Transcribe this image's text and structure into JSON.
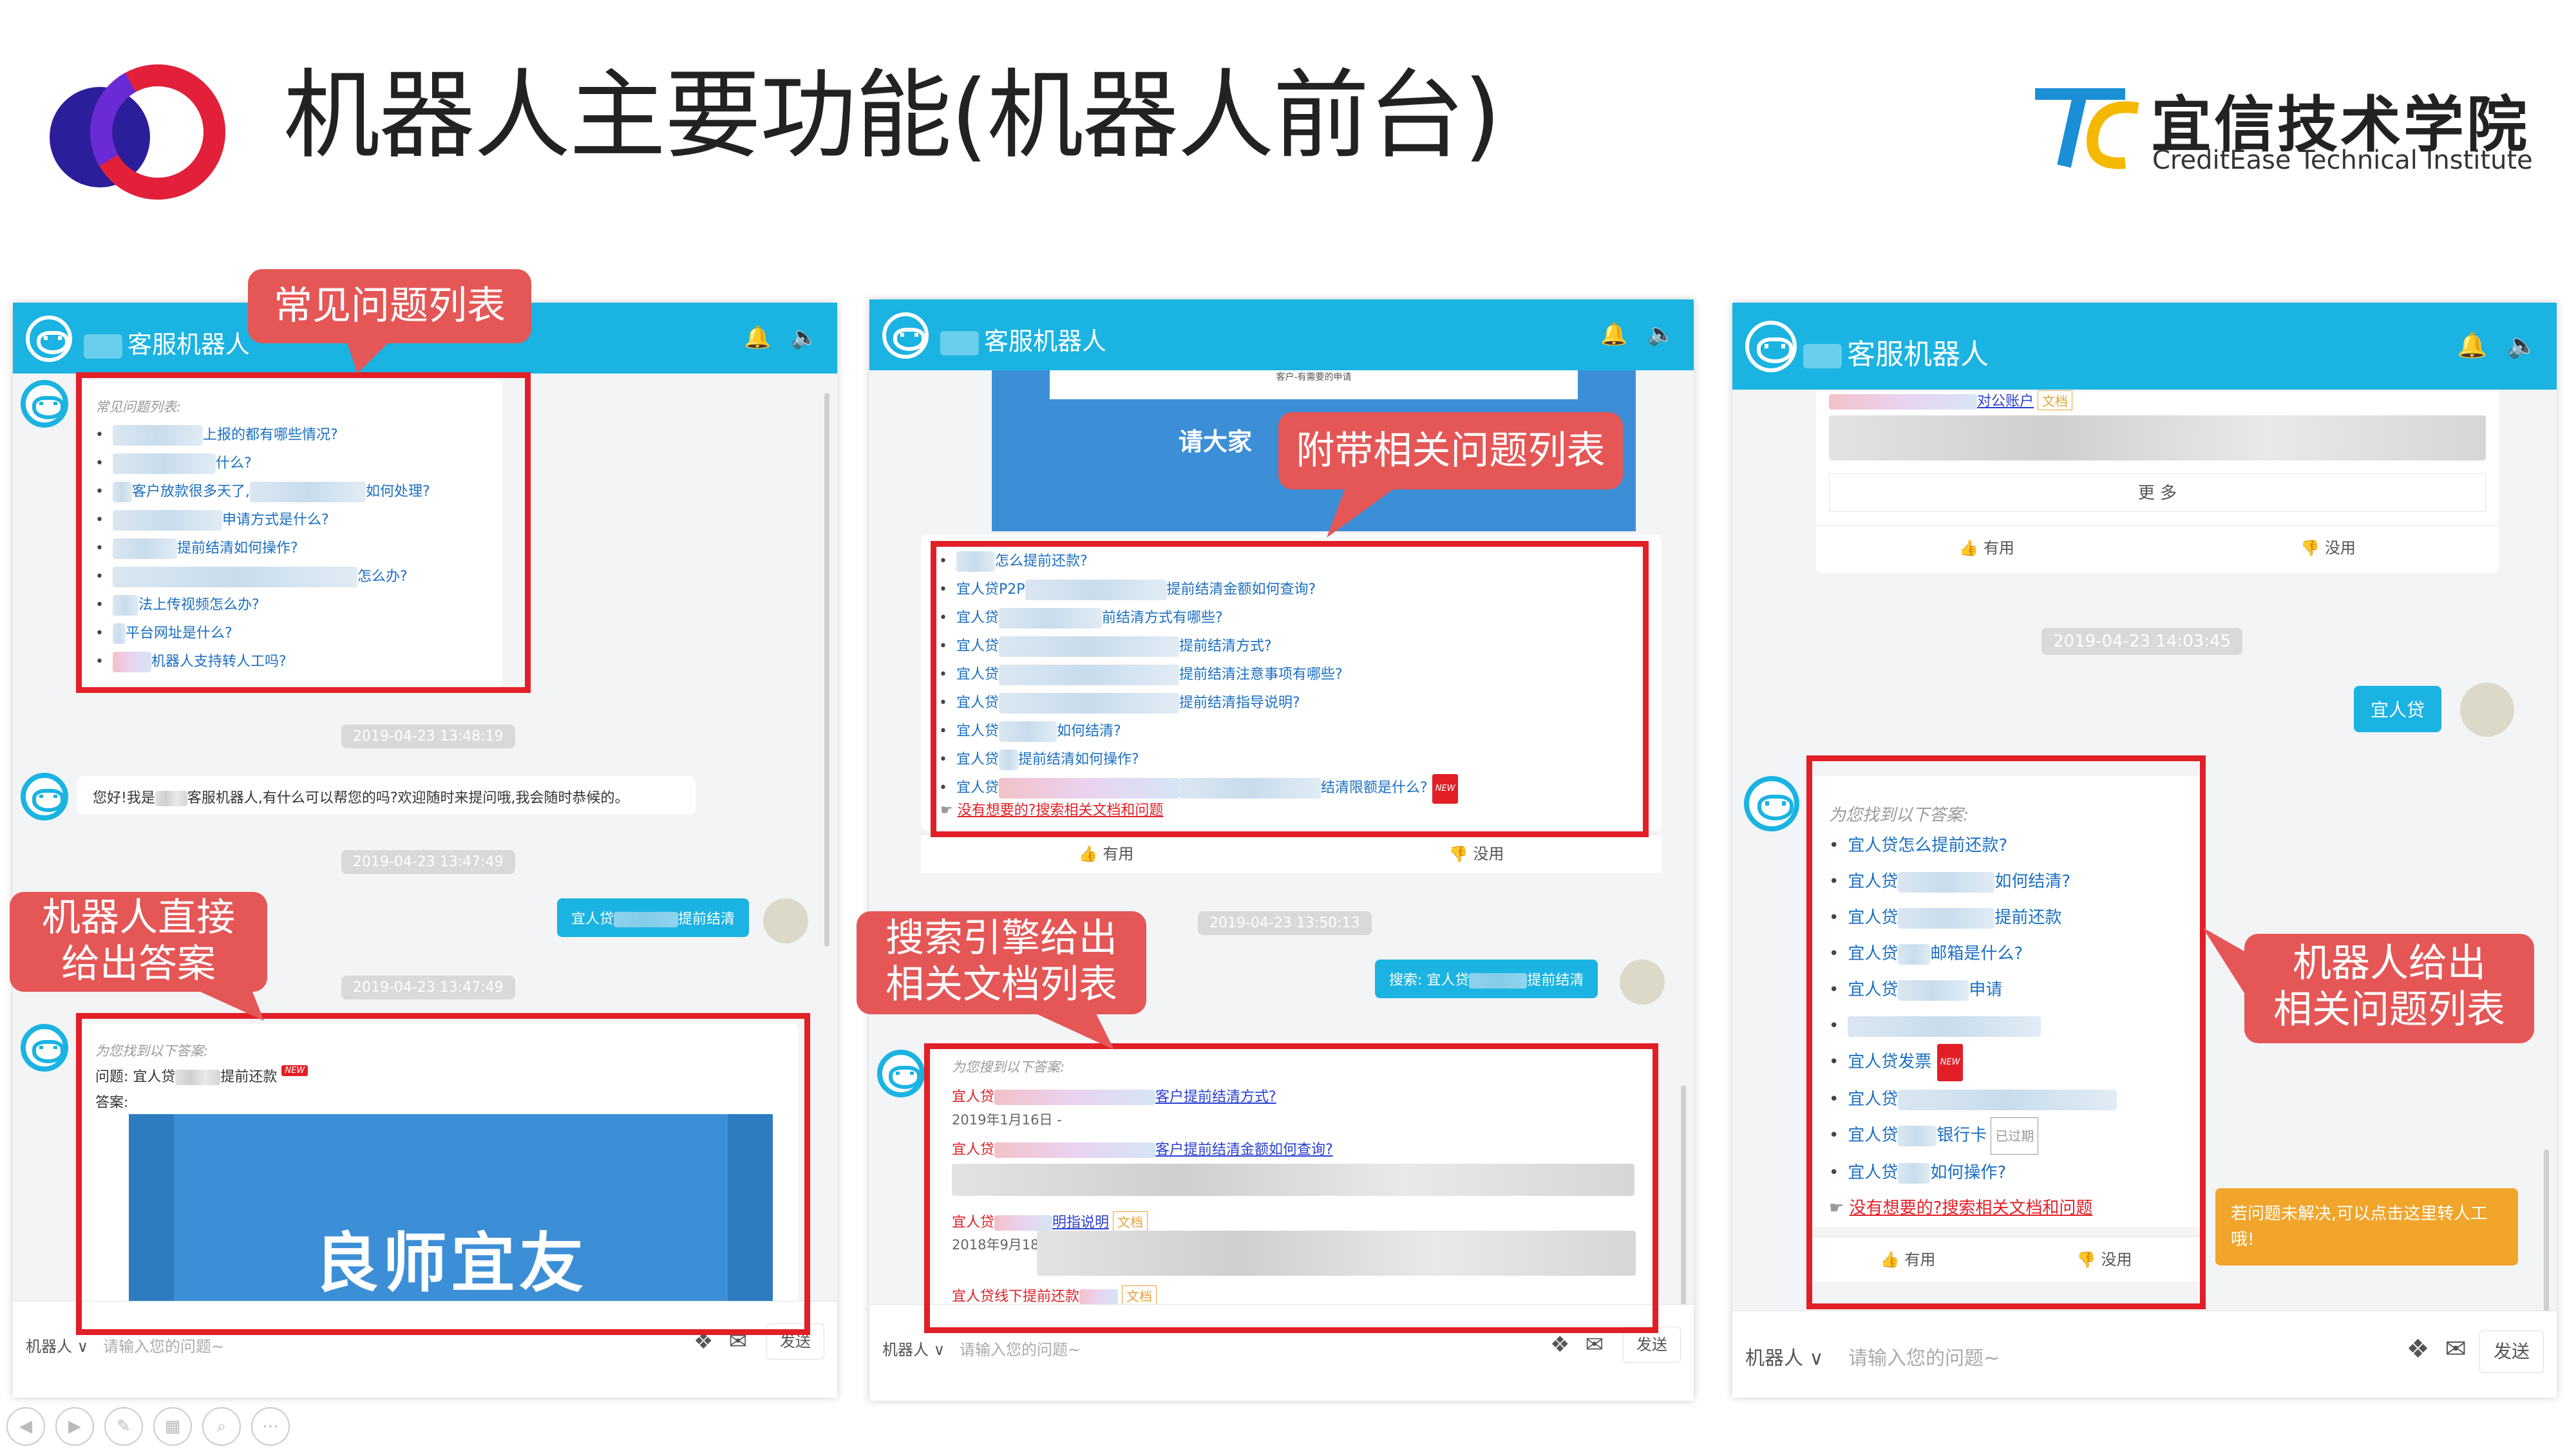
{
  "slide": {
    "title": "机器人主要功能(机器人前台)",
    "brand_cn": "宜信技术学院",
    "brand_en": "CreditEase Technical Institute",
    "colors": {
      "accent": "#1ab3e2",
      "callout": "#e55656",
      "highlight": "#e21f26",
      "tip": "#f1a52a"
    }
  },
  "common": {
    "robot_name": "客服机器人",
    "robot_selector": "机器人 ∨",
    "placeholder": "请输入您的问题~",
    "send": "发送",
    "useful": "有用",
    "useless": "没用",
    "more": "更 多",
    "icons": [
      "bell-icon",
      "speaker-icon",
      "apps-icon",
      "mail-icon",
      "thumb-up-icon",
      "thumb-down-icon"
    ]
  },
  "callouts": {
    "faq_list": "常见问题列表",
    "direct_answer_1": "机器人直接",
    "direct_answer_2": "给出答案",
    "related_list": "附带相关问题列表",
    "search_1": "搜索引擎给出",
    "search_2": "相关文档列表",
    "robot_related_1": "机器人给出",
    "robot_related_2": "相关问题列表"
  },
  "panel1": {
    "faq_header": "常见问题列表:",
    "faq_items": [
      "上报的都有哪些情况?",
      "什么?",
      "客户放款很多天了,",
      "如何处理?",
      "申请方式是什么?",
      "提前结清如何操作?",
      "怎么办?",
      "法上传视频怎么办?",
      "平台网址是什么?",
      "机器人支持转人工吗?"
    ],
    "time1": "2019-04-23 13:48:19",
    "greeting_a": "您好!我是",
    "greeting_b": "客服机器人,有什么可以帮您的吗?欢迎随时来提问哦,我会随时恭候的。",
    "time2": "2019-04-23 13:47:49",
    "user_msg_a": "宜人贷",
    "user_msg_b": "提前结清",
    "time3": "2019-04-23 13:47:49",
    "answer_header": "为您找到以下答案:",
    "question_label": "问题: 宜人贷",
    "question_tail": "提前还款",
    "answer_label": "答案:",
    "banner_text": "良师宜友",
    "new_badge": "NEW"
  },
  "panel2": {
    "banner_top": "客户-有需要的申请",
    "banner_mid": "请大家",
    "related_items": [
      "怎么提前还款?",
      "宜人贷P2P",
      "提前结清金额如何查询?",
      "宜人贷",
      "前结清方式有哪些?",
      "提前结清方式?",
      "提前结清注意事项有哪些?",
      "提前结清指导说明?",
      "如何结清?",
      "提前结清如何操作?",
      "结清限额是什么?"
    ],
    "more_link": "没有想要的?搜索相关文档和问题",
    "time": "2019-04-23 13:50:13",
    "user_msg": "搜索: 宜人贷",
    "user_msg_tail": "提前结清",
    "search_header": "为您搜到以下答案:",
    "doc1_t": "宜人贷",
    "doc1_u": "客户提前结清方式?",
    "doc1_date": "2019年1月16日 -",
    "doc2_t": "宜人贷",
    "doc2_u": "客户提前结清金额如何查询?",
    "doc3_t": "宜人贷",
    "doc3_u": "明指说明",
    "doc3_tag": "文档",
    "doc3_date": "2018年9月18日 -",
    "doc4": "宜人贷线下提前还款",
    "doc4_tag": "文档"
  },
  "panel3": {
    "top_link": "对公账户",
    "top_tag": "文档",
    "time": "2019-04-23 14:03:45",
    "user_msg": "宜人贷",
    "answer_header": "为您找到以下答案:",
    "items": [
      "宜人贷怎么提前还款?",
      "宜人贷",
      "如何结清?",
      "提前还款",
      "邮箱是什么?",
      "申请",
      "宜人贷发票",
      "银行卡",
      "已过期",
      "如何操作?"
    ],
    "prefix": "宜人贷",
    "more_link": "没有想要的?搜索相关文档和问题",
    "tip": "若问题未解决,可以点击这里转人工哦!"
  }
}
